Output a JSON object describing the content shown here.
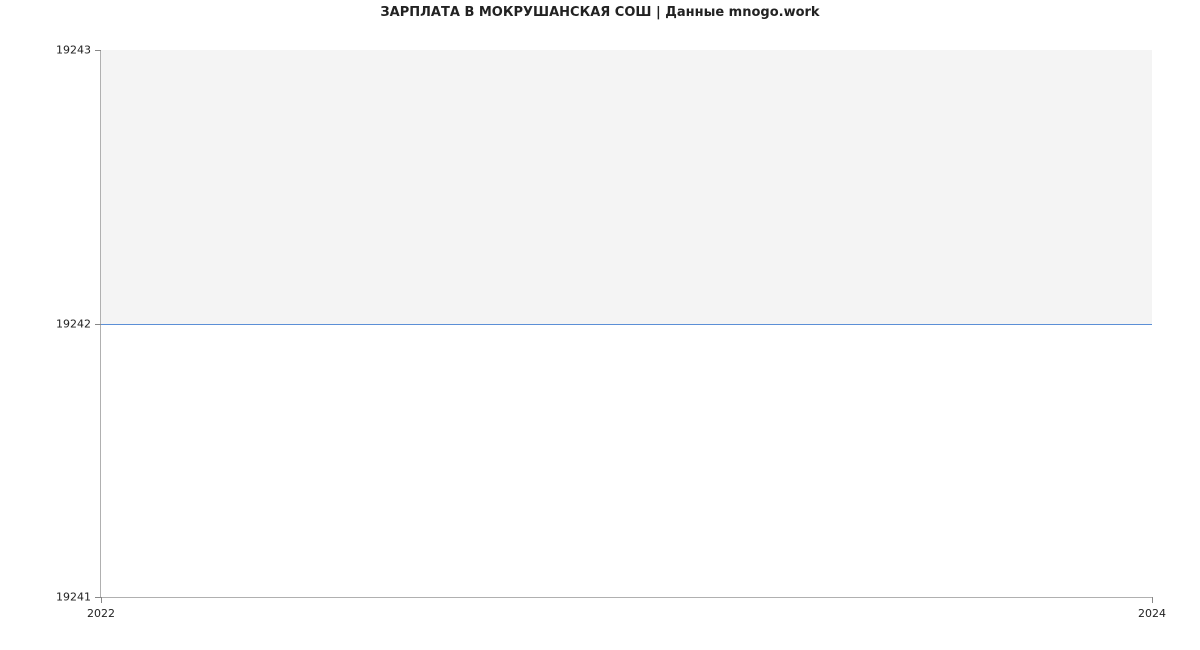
{
  "chart_data": {
    "type": "line",
    "title": "ЗАРПЛАТА В МОКРУШАНСКАЯ СОШ | Данные mnogo.work",
    "xlabel": "",
    "ylabel": "",
    "x": [
      2022,
      2024
    ],
    "y": [
      19242,
      19242
    ],
    "x_ticks": [
      2022,
      2024
    ],
    "y_ticks": [
      19241,
      19242,
      19243
    ],
    "ylim": [
      19241,
      19243
    ],
    "xlim": [
      2022,
      2024
    ],
    "line_color": "#5b8fd6"
  }
}
